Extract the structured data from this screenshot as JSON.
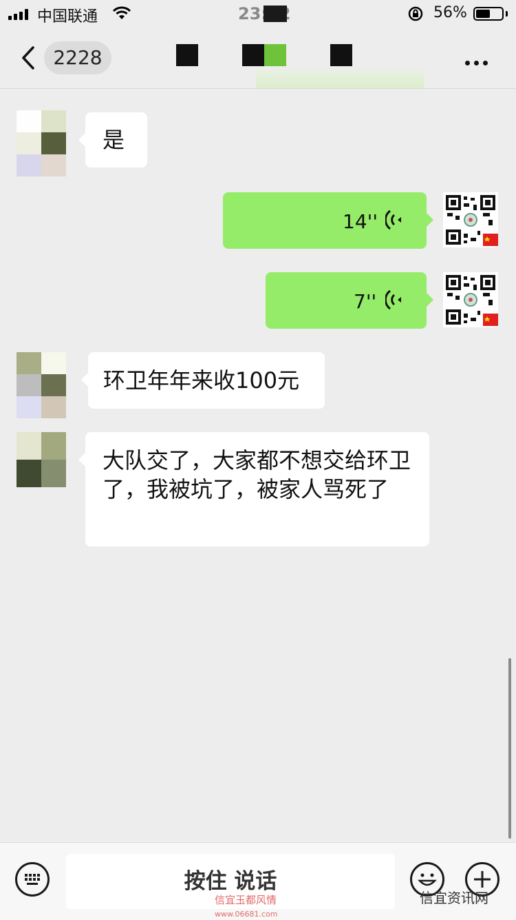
{
  "status": {
    "carrier": "中国联通",
    "time": "23:12",
    "battery_percent_label": "56%",
    "battery_level": 0.56
  },
  "nav": {
    "unread_count": "2228"
  },
  "messages": [
    {
      "side": "in",
      "type": "text",
      "text": "是"
    },
    {
      "side": "out",
      "type": "voice",
      "duration": "14''"
    },
    {
      "side": "out",
      "type": "voice",
      "duration": "7''"
    },
    {
      "side": "in",
      "type": "text",
      "text": "环卫年年来收100元"
    },
    {
      "side": "in",
      "type": "text",
      "text": "大队交了，大家都不想交给环卫了，我被坑了，被家人骂死了"
    }
  ],
  "input": {
    "hold_to_talk_label": "按住 说话"
  },
  "watermarks": {
    "left": "信宜玉都风情",
    "left_url": "www.06681.com",
    "right": "信宜资讯网"
  },
  "colors": {
    "background": "#ededed",
    "outgoing_bubble": "#95ec69",
    "incoming_bubble": "#ffffff"
  }
}
